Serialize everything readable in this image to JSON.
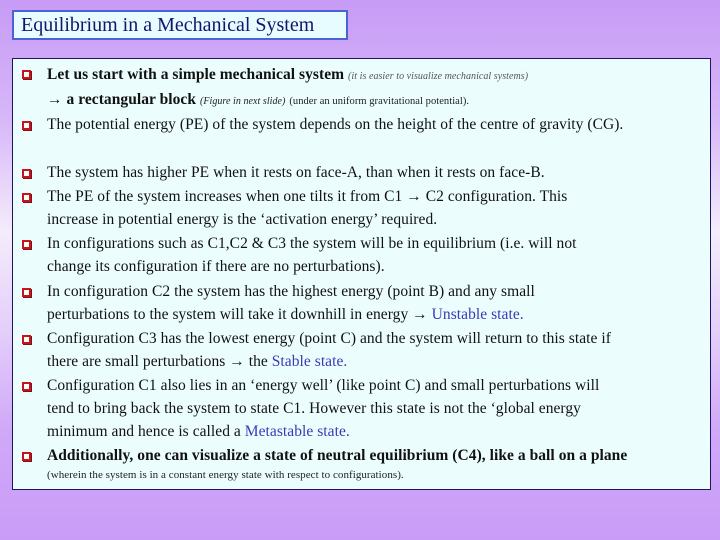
{
  "slide": {
    "title": "Equilibrium in a Mechanical System",
    "bullet_icon": "hollow-square-bullet",
    "colors": {
      "background_top": "#c79bf6",
      "background_mid": "#f4ecfc",
      "title_fill": "#e6fcff",
      "title_border": "#4b62d6",
      "title_text": "#14146e",
      "panel_fill": "#ecfdfe",
      "bullet": "#c4141c",
      "accent_text": "#3a3ab4"
    },
    "bullets": [
      {
        "line1": "Let us start with a simple mechanical system",
        "note1": "(it is easier to visualize mechanical systems)",
        "line2_arrow": "→ a rectangular block",
        "note2": "(Figure in next slide)",
        "note3": "(under an uniform gravitational potential)."
      },
      {
        "text": "The potential energy (PE) of the system depends on the height of the centre of gravity (CG)."
      },
      {
        "text": "The system has higher PE when it rests on face-A, than when it rests on face-B."
      },
      {
        "line1": "The PE of the system increases when one tilts it from C1 → C2 configuration. This",
        "line2": "increase in potential energy is the ‘activation energy’ required."
      },
      {
        "line1": "In configurations such as C1,C2 & C3 the system will be in equilibrium (i.e. will not",
        "line2": "change its configuration if there are no perturbations)."
      },
      {
        "line1": "In configuration C2 the system has the highest energy (point B) and any small",
        "line2": "perturbations to the system will take it downhill in energy →",
        "accent": "Unstable state."
      },
      {
        "line1": "Configuration C3 has the lowest energy (point C) and  the system will return to this state if",
        "line2": "there are small perturbations → the",
        "accent": "Stable state."
      },
      {
        "line1": "Configuration C1 also lies in an ‘energy well’ (like point C) and small perturbations will",
        "line2": "tend to bring back the system to state C1. However this state is not the ‘global energy",
        "line3": "minimum and hence is called a",
        "accent": "Metastable state."
      },
      {
        "line1": "Additionally, one can visualize a state of neutral equilibrium (C4), like a ball on a plane",
        "note": "(wherein  the system is in a constant energy state with respect to configurations)."
      }
    ]
  }
}
